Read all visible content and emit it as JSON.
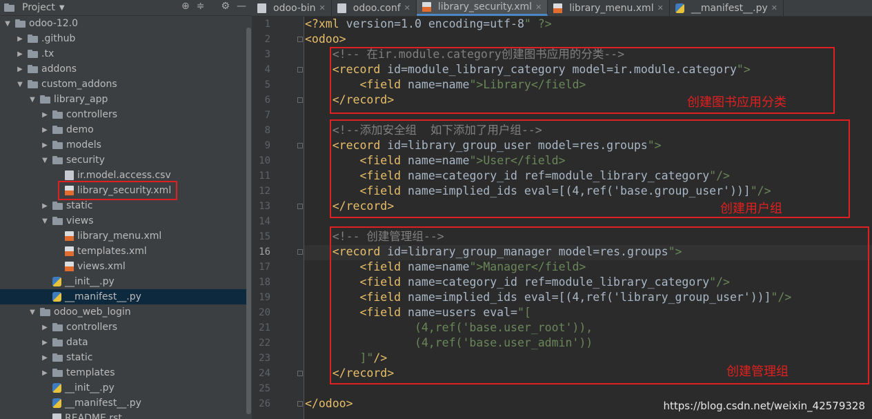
{
  "sidebar": {
    "title": "Project",
    "header_icons": [
      "target-icon",
      "collapse-icon",
      "gear-icon",
      "minimize-icon"
    ],
    "rows": [
      {
        "label": "odoo-12.0",
        "type": "folder",
        "expanded": true
      },
      {
        "label": ".github",
        "type": "folder",
        "expanded": false
      },
      {
        "label": ".tx",
        "type": "folder",
        "expanded": false
      },
      {
        "label": "addons",
        "type": "folder",
        "expanded": false
      },
      {
        "label": "custom_addons",
        "type": "folder",
        "expanded": true
      },
      {
        "label": "library_app",
        "type": "folder",
        "expanded": true
      },
      {
        "label": "controllers",
        "type": "folder",
        "expanded": false
      },
      {
        "label": "demo",
        "type": "folder",
        "expanded": false
      },
      {
        "label": "models",
        "type": "folder",
        "expanded": false
      },
      {
        "label": "security",
        "type": "folder",
        "expanded": true
      },
      {
        "label": "ir.model.access.csv",
        "type": "csv"
      },
      {
        "label": "library_security.xml",
        "type": "xml"
      },
      {
        "label": "static",
        "type": "folder",
        "expanded": false
      },
      {
        "label": "views",
        "type": "folder",
        "expanded": true
      },
      {
        "label": "library_menu.xml",
        "type": "xml"
      },
      {
        "label": "templates.xml",
        "type": "xml"
      },
      {
        "label": "views.xml",
        "type": "xml"
      },
      {
        "label": "__init__.py",
        "type": "py"
      },
      {
        "label": "__manifest__.py",
        "type": "py",
        "selected": true
      },
      {
        "label": "odoo_web_login",
        "type": "folder",
        "expanded": true
      },
      {
        "label": "controllers",
        "type": "folder",
        "expanded": false
      },
      {
        "label": "data",
        "type": "folder",
        "expanded": false
      },
      {
        "label": "static",
        "type": "folder",
        "expanded": false
      },
      {
        "label": "templates",
        "type": "folder",
        "expanded": false
      },
      {
        "label": "__init__.py",
        "type": "py"
      },
      {
        "label": "__manifest__.py",
        "type": "py"
      },
      {
        "label": "README.rst",
        "type": "rst"
      }
    ]
  },
  "tabs": [
    {
      "label": "odoo-bin",
      "icon": "file-icon",
      "active": false
    },
    {
      "label": "odoo.conf",
      "icon": "file-icon",
      "active": false
    },
    {
      "label": "library_security.xml",
      "icon": "xml-file-icon",
      "active": true
    },
    {
      "label": "library_menu.xml",
      "icon": "xml-file-icon",
      "active": false
    },
    {
      "label": "__manifest__.py",
      "icon": "python-file-icon",
      "active": false
    }
  ],
  "editor": {
    "current_line": 16,
    "line_numbers": [
      "1",
      "2",
      "3",
      "4",
      "5",
      "6",
      "7",
      "8",
      "9",
      "10",
      "11",
      "12",
      "13",
      "14",
      "15",
      "16",
      "17",
      "18",
      "19",
      "20",
      "21",
      "22",
      "23",
      "24",
      "25",
      "26"
    ],
    "lines": [
      "<?xml version=\"1.0\" encoding=\"utf-8\" ?>",
      "<odoo>",
      "    <!-- 在ir.module.category创建图书应用的分类-->",
      "    <record id=\"module_library_category\" model=\"ir.module.category\">",
      "        <field name=\"name\">Library</field>",
      "    </record>",
      "",
      "    <!--添加安全组  如下添加了用户组-->",
      "    <record id=\"library_group_user\" model=\"res.groups\">",
      "        <field name=\"name\">User</field>",
      "        <field name=\"category_id\" ref=\"module_library_category\"/>",
      "        <field name=\"implied_ids\" eval=\"[(4,ref('base.group_user'))]\"/>",
      "    </record>",
      "",
      "    <!-- 创建管理组-->",
      "    <record id=\"library_group_manager\" model=\"res.groups\">",
      "        <field name=\"name\">Manager</field>",
      "        <field name=\"category_id\" ref=\"module_library_category\"/>",
      "        <field name=\"implied_ids\" eval=\"[(4,ref('library_group_user'))]\"/>",
      "        <field name=\"users\" eval=\"[",
      "                (4,ref('base.user_root')),",
      "                (4,ref('base.user_admin'))",
      "        ]\"/>",
      "    </record>",
      "",
      "</odoo>"
    ]
  },
  "annotations": {
    "category": "创建图书应用分类",
    "user_group": "创建用户组",
    "manager_group": "创建管理组"
  },
  "watermark": "https://blog.csdn.net/weixin_42579328",
  "colors": {
    "annotation_red": "#e02020",
    "tag": "#e8bf6a",
    "attr_value": "#6a8759",
    "comment": "#808080",
    "selection": "#0d293e"
  }
}
